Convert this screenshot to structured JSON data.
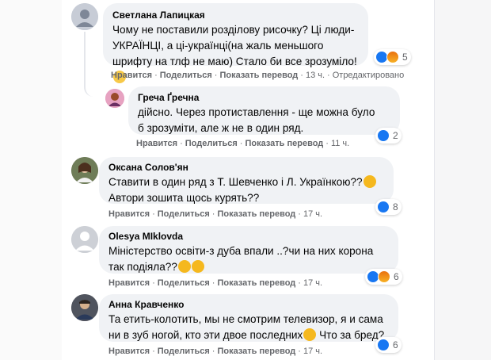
{
  "actions": {
    "like": "Нравится",
    "share": "Поделиться",
    "translate": "Показать перевод",
    "dot": "·"
  },
  "comments": [
    {
      "author": "Светлана Лапицкая",
      "lines": [
        "Чому не поставили розділову рисочку? Ці люди-",
        "УКРАЇНЦІ, а ці-українці(на жаль меньшого",
        "шрифту на тлф не маю) Стало би все зрозуміло!"
      ],
      "time": "13 ч.",
      "edited": "Отредактировано",
      "reaction_count": "5",
      "reactions": [
        "like-icon",
        "angry-icon"
      ]
    },
    {
      "author": "Греча Ґречна",
      "lines": [
        "дійсно. Через протиставлення - ще можна було",
        "б зрозуміти, але ж не в один ряд."
      ],
      "time": "11 ч.",
      "reaction_count": "2",
      "reactions": [
        "like-icon"
      ]
    },
    {
      "author": "Оксана Солов'ян",
      "lines": [
        "Ставити в один ряд з Т. Шевченко і Л. Українкою??",
        "Автори зошита щось курять??"
      ],
      "time": "17 ч.",
      "reaction_count": "8",
      "reactions": [
        "like-icon"
      ]
    },
    {
      "author": "Olesya MIklovda",
      "lines": [
        "Міністерство освіти-з дуба впали ..?чи на них корона",
        "так подіяла??"
      ],
      "time": "17 ч.",
      "reaction_count": "6",
      "reactions": [
        "like-icon",
        "angry-icon"
      ]
    },
    {
      "author": "Анна Кравченко",
      "lines": [
        "Та етить-колотить, мы не смотрим телевизор, я и сама",
        "ни в зуб ногой, кто эти двое последних",
        "Что за бред?"
      ],
      "time": "17 ч.",
      "reaction_count": "6",
      "reactions": [
        "like-icon"
      ]
    }
  ],
  "colors": {
    "bubble": "#f0f2f5",
    "meta": "#65676b",
    "like": "#1877f2",
    "angry": "#e9710f"
  }
}
